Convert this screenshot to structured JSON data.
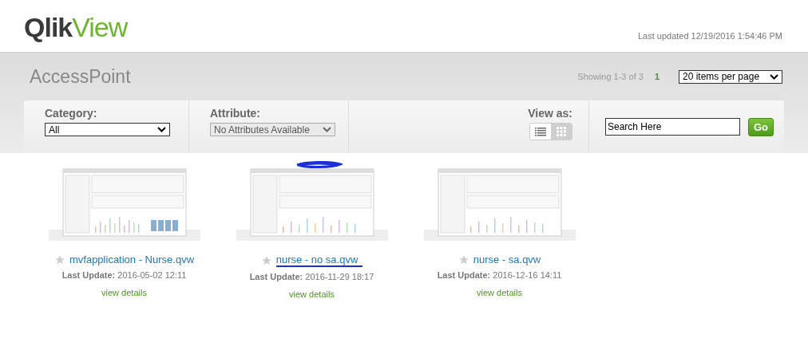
{
  "header": {
    "logo_dark": "Qlik",
    "logo_light": "View",
    "last_updated": "Last updated 12/19/2016 1:54:46 PM"
  },
  "title": "AccessPoint",
  "paging": {
    "showing": "Showing 1-3 of 3",
    "page": "1",
    "per_page": "20 items per page"
  },
  "toolbar": {
    "category_label": "Category:",
    "category_value": "All",
    "attribute_label": "Attribute:",
    "attribute_value": "No Attributes Available",
    "attribute_disabled": true,
    "view_label": "View as:",
    "views": [
      {
        "kind": "list",
        "selected": false
      },
      {
        "kind": "grid",
        "selected": true
      }
    ],
    "search_placeholder": "Search Here",
    "go": "Go"
  },
  "documents": [
    {
      "name": "mvfapplication - Nurse.qvw",
      "update_label": "Last Update:",
      "update_value": "2016-05-02 12:11",
      "details": "view details",
      "marked": false
    },
    {
      "name": "nurse - no sa.qvw",
      "update_label": "Last Update:",
      "update_value": "2016-11-29 18:17",
      "details": "view details",
      "marked": true
    },
    {
      "name": "nurse - sa.qvw",
      "update_label": "Last Update:",
      "update_value": "2016-12-16 14:11",
      "details": "view details",
      "marked": false
    }
  ]
}
